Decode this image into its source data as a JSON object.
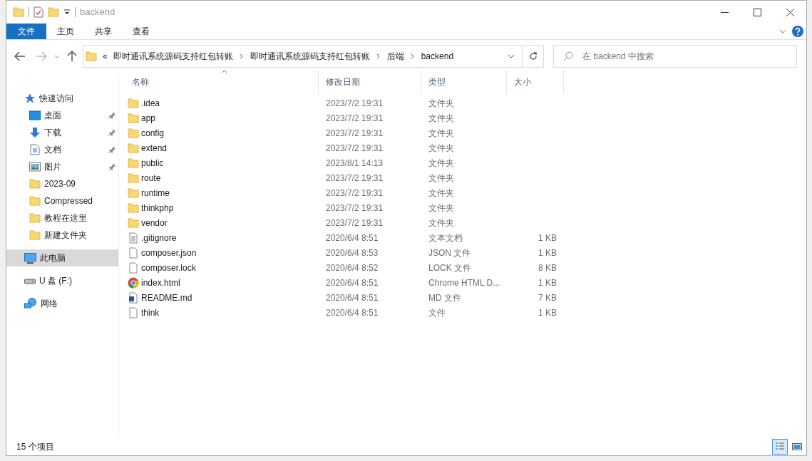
{
  "window": {
    "title": "backend"
  },
  "ribbon_tabs": [
    {
      "label": "文件",
      "kind": "file",
      "selected": false
    },
    {
      "label": "主页",
      "kind": "tab",
      "selected": false
    },
    {
      "label": "共享",
      "kind": "tab",
      "selected": false
    },
    {
      "label": "查看",
      "kind": "tab",
      "selected": false
    }
  ],
  "address": {
    "overflow": "«",
    "segments": [
      "即时通讯系统源码支持红包转账",
      "即时通讯系统源码支持红包转账",
      "后端",
      "backend"
    ]
  },
  "search": {
    "placeholder": "在 backend 中搜索"
  },
  "navigation": [
    {
      "label": "快速访问",
      "kind": "quick",
      "selected": false,
      "children": [
        {
          "label": "桌面",
          "kind": "desktop",
          "pinned": true
        },
        {
          "label": "下载",
          "kind": "download",
          "pinned": true
        },
        {
          "label": "文档",
          "kind": "documents",
          "pinned": true
        },
        {
          "label": "图片",
          "kind": "pictures",
          "pinned": true
        },
        {
          "label": "2023-09",
          "kind": "folder",
          "pinned": false
        },
        {
          "label": "Compressed",
          "kind": "folder",
          "pinned": false
        },
        {
          "label": "教程在这里",
          "kind": "folder",
          "pinned": false
        },
        {
          "label": "新建文件夹",
          "kind": "folder",
          "pinned": false
        }
      ]
    },
    {
      "label": "此电脑",
      "kind": "pc",
      "selected": true
    },
    {
      "label": "U 盘 (F:)",
      "kind": "drive",
      "selected": false
    },
    {
      "label": "网络",
      "kind": "network",
      "selected": false
    }
  ],
  "table": {
    "columns": [
      {
        "label": "名称",
        "sorted": true
      },
      {
        "label": "修改日期",
        "sorted": false
      },
      {
        "label": "类型",
        "sorted": false
      },
      {
        "label": "大小",
        "sorted": false
      }
    ],
    "rows": [
      {
        "kind": "folder",
        "name": ".idea",
        "date": "2023/7/2 19:31",
        "type": "文件夹"
      },
      {
        "kind": "folder",
        "name": "app",
        "date": "2023/7/2 19:31",
        "type": "文件夹"
      },
      {
        "kind": "folder",
        "name": "config",
        "date": "2023/7/2 19:31",
        "type": "文件夹"
      },
      {
        "kind": "folder",
        "name": "extend",
        "date": "2023/7/2 19:31",
        "type": "文件夹"
      },
      {
        "kind": "folder",
        "name": "public",
        "date": "2023/8/1 14:13",
        "type": "文件夹"
      },
      {
        "kind": "folder",
        "name": "route",
        "date": "2023/7/2 19:31",
        "type": "文件夹"
      },
      {
        "kind": "folder",
        "name": "runtime",
        "date": "2023/7/2 19:31",
        "type": "文件夹"
      },
      {
        "kind": "folder",
        "name": "thinkphp",
        "date": "2023/7/2 19:31",
        "type": "文件夹"
      },
      {
        "kind": "folder",
        "name": "vendor",
        "date": "2023/7/2 19:31",
        "type": "文件夹"
      },
      {
        "kind": "text",
        "name": ".gitignore",
        "date": "2020/6/4 8:51",
        "type": "文本文档",
        "size": "1 KB"
      },
      {
        "kind": "file",
        "name": "composer.json",
        "date": "2020/6/4 8:53",
        "type": "JSON 文件",
        "size": "1 KB"
      },
      {
        "kind": "file",
        "name": "composer.lock",
        "date": "2020/6/4 8:52",
        "type": "LOCK 文件",
        "size": "8 KB"
      },
      {
        "kind": "chrome",
        "name": "index.html",
        "date": "2020/6/4 8:51",
        "type": "Chrome HTML D...",
        "size": "1 KB"
      },
      {
        "kind": "word",
        "name": "README.md",
        "date": "2020/6/4 8:51",
        "type": "MD 文件",
        "size": "7 KB"
      },
      {
        "kind": "file",
        "name": "think",
        "date": "2020/6/4 8:51",
        "type": "文件",
        "size": "1 KB"
      }
    ]
  },
  "status_bar": {
    "count": "15 个项目",
    "views": [
      {
        "kind": "details",
        "selected": true
      },
      {
        "kind": "tiles",
        "selected": false
      }
    ]
  }
}
